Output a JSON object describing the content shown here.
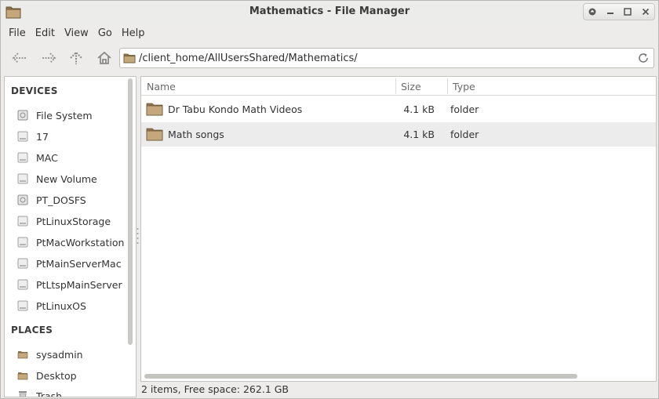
{
  "window": {
    "title": "Mathematics - File Manager",
    "controls": [
      "up-icon",
      "minimize-icon",
      "maximize-icon",
      "close-icon"
    ]
  },
  "menubar": {
    "items": [
      "File",
      "Edit",
      "View",
      "Go",
      "Help"
    ]
  },
  "toolbar": {
    "buttons": [
      "back-icon",
      "forward-icon",
      "parent-icon",
      "home-icon"
    ],
    "location": "/client_home/AllUsersShared/Mathematics/"
  },
  "sidebar": {
    "devices_header": "DEVICES",
    "devices": [
      "File System",
      "17",
      "MAC",
      "New Volume",
      "PT_DOSFS",
      "PtLinuxStorage",
      "PtMacWorkstation",
      "PtMainServerMac",
      "PtLtspMainServer",
      "PtLinuxOS"
    ],
    "places_header": "PLACES",
    "places": [
      "sysadmin",
      "Desktop",
      "Trash"
    ]
  },
  "filelist": {
    "columns": {
      "name": "Name",
      "size": "Size",
      "type": "Type"
    },
    "rows": [
      {
        "name": "Dr Tabu Kondo Math Videos",
        "size": "4.1 kB",
        "type": "folder"
      },
      {
        "name": "Math songs",
        "size": "4.1 kB",
        "type": "folder"
      }
    ]
  },
  "status": "2 items, Free space: 262.1 GB",
  "colors": {
    "folder": "#b89a6b",
    "alt_row": "#ececec",
    "window_bg": "#edecea"
  }
}
